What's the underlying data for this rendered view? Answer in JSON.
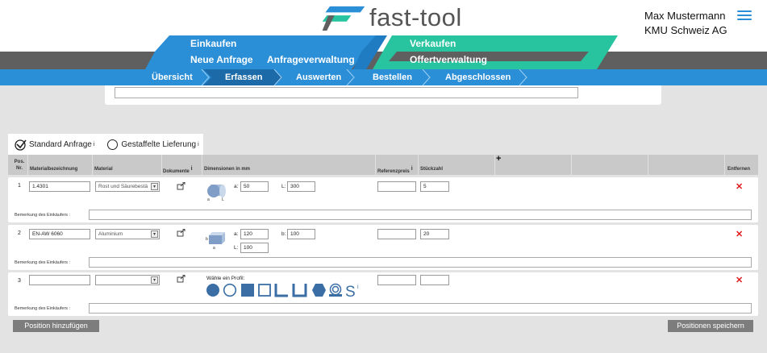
{
  "app": {
    "logo_text": "fast-tool"
  },
  "user": {
    "name": "Max Mustermann",
    "company": "KMU Schweiz AG"
  },
  "nav": {
    "einkaufen": "Einkaufen",
    "neue_anfrage": "Neue Anfrage",
    "anfrageverwaltung": "Anfrageverwaltung",
    "verkaufen": "Verkaufen",
    "offertverwaltung": "Offertverwaltung"
  },
  "steps": [
    "Übersicht",
    "Erfassen",
    "Auswerten",
    "Bestellen",
    "Abgeschlossen"
  ],
  "request_type": {
    "standard": "Standard Anfrage",
    "staggered": "Gestaffelte Lieferung",
    "info": "i"
  },
  "table": {
    "headers": {
      "pos": "Pos.",
      "nr": "Nr.",
      "material_name": "Materialbezeichnung",
      "material": "Material",
      "documents": "Dokumente",
      "dimensions": "Dimensionen in mm",
      "reference_price": "Referenzpreis",
      "quantity": "Stückzahl",
      "remove": "Entfernen",
      "add": "+"
    },
    "rows": [
      {
        "pos": "1",
        "material_name": "1.4301",
        "material": "Rost und Säurebestä",
        "dim_a_label": "a:",
        "dim_a": "50",
        "dim_l_label": "L:",
        "dim_l": "300",
        "quantity": "5",
        "remark_label": "Bemerkung des Einkäufers :"
      },
      {
        "pos": "2",
        "material_name": "EN-AW 6060",
        "material": "Aluminium",
        "dim_a_label": "a:",
        "dim_a": "120",
        "dim_b_label": "b:",
        "dim_b": "100",
        "dim_l_label": "L:",
        "dim_l": "100",
        "quantity": "20",
        "remark_label": "Bemerkung des Einkäufers :"
      },
      {
        "pos": "3",
        "material_name": "",
        "material": "",
        "profile_prompt": "Wähle ein Profil:",
        "quantity": "",
        "remark_label": "Bemerkung des Einkäufers :"
      }
    ],
    "delete_icon": "✕"
  },
  "buttons": {
    "add_position": "Position hinzufügen",
    "save_positions": "Positionen speichern"
  },
  "colors": {
    "blue": "#2b8fd8",
    "teal": "#28c4a0",
    "dark": "#5f5f5f",
    "profile": "#3a6ea5",
    "delete": "#e01b1b"
  },
  "profile_icons": [
    "round-bar-icon",
    "tube-icon",
    "square-bar-icon",
    "square-tube-icon",
    "angle-profile-icon",
    "u-profile-icon",
    "hexagon-bar-icon",
    "coil-icon",
    "s-profile-icon"
  ]
}
